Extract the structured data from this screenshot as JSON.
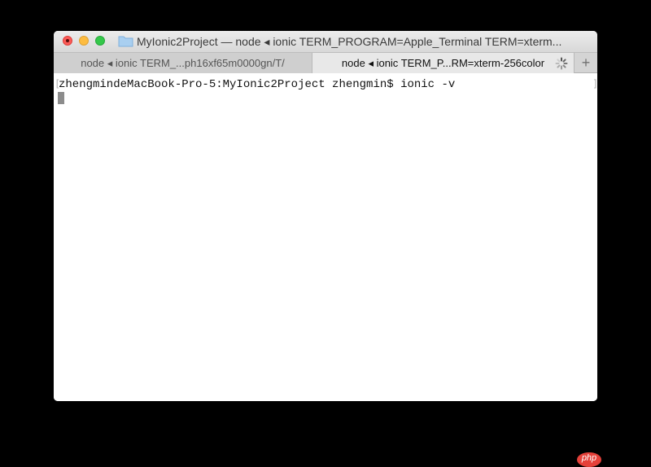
{
  "window": {
    "title": "MyIonic2Project — node ◂ ionic TERM_PROGRAM=Apple_Terminal TERM=xterm..."
  },
  "tabs": [
    {
      "label": "node ◂ ionic TERM_...ph16xf65m0000gn/T/",
      "active": false
    },
    {
      "label": "node ◂ ionic TERM_P...RM=xterm-256color",
      "active": true
    }
  ],
  "tab_add": {
    "label": "+"
  },
  "terminal": {
    "bracket_left": "[",
    "bracket_right": "]",
    "line": "zhengmindeMacBook-Pro-5:MyIonic2Project zhengmin$ ionic -v"
  },
  "watermark": {
    "text": "php"
  },
  "colors": {
    "close": "#fc5b57",
    "minimize": "#fdbc40",
    "maximize": "#34c84a",
    "folder": "#a9cff0"
  },
  "icons": {
    "folder": "folder-icon",
    "spinner": "loading-spinner-icon",
    "add_tab": "plus-icon"
  }
}
